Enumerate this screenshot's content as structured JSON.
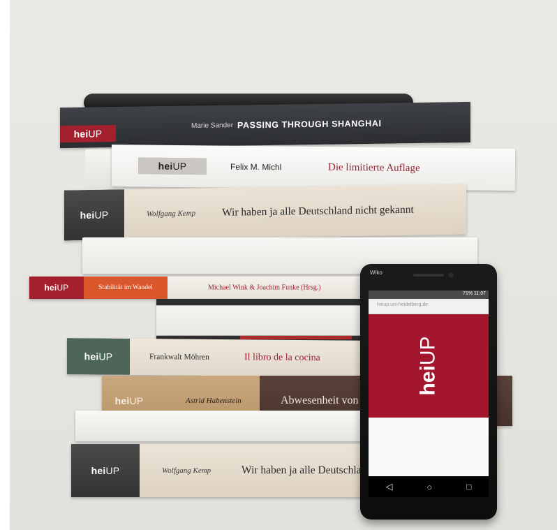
{
  "books": [
    {
      "logo_bold": "hei",
      "logo_light": "UP",
      "author": "Marie Sander",
      "title": "PASSING THROUGH SHANGHAI"
    },
    {
      "logo_bold": "hei",
      "logo_light": "UP",
      "author": "Felix M. Michl",
      "title": "Die limitierte Auflage"
    },
    {
      "logo_bold": "hei",
      "logo_light": "UP",
      "author": "Wolfgang Kemp",
      "title": "Wir haben ja alle Deutschland nicht gekannt"
    },
    {
      "logo_bold": "hei",
      "logo_light": "UP",
      "series": "Stabilität im Wandel",
      "author": "Michael Wink & Joachim Funke (Hrsg.)"
    },
    {
      "logo_bold": "hei",
      "logo_light": "UP",
      "author": "Frankwalt Möhren",
      "title": "Il libro de la cocina"
    },
    {
      "logo_bold": "hei",
      "logo_light": "UP",
      "author": "Astrid Habenstein",
      "title": "Abwesenheit von"
    },
    {
      "logo_bold": "hei",
      "logo_light": "UP",
      "author": "Wolfgang Kemp",
      "title": "Wir haben ja alle Deutschla"
    }
  ],
  "phone": {
    "brand": "Wiko",
    "status_time": "71% 11:07",
    "url": "heiup.uni-heidelberg.de",
    "screen_logo_bold": "hei",
    "screen_logo_light": "UP",
    "nav_back": "◁",
    "nav_home": "○",
    "nav_recent": "□"
  },
  "colors": {
    "brand_red": "#a5202e",
    "backdrop": "#e8e6e1"
  }
}
